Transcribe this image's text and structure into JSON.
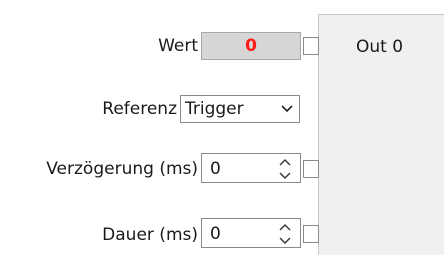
{
  "fields": {
    "wert_label": "Wert",
    "wert_value": "0",
    "referenz_label": "Referenz",
    "referenz_selected": "Trigger",
    "verzoegerung_label": "Verzögerung (ms)",
    "verzoegerung_value": "0",
    "dauer_label": "Dauer (ms)",
    "dauer_value": "0"
  },
  "panel": {
    "title": "Out 0"
  },
  "colors": {
    "value_text": "#ff1a1a",
    "panel_bg": "#f0f0f0"
  },
  "icons": {
    "dropdown": "chevron-down-icon",
    "spinner": "up-down-chevron-icon"
  }
}
